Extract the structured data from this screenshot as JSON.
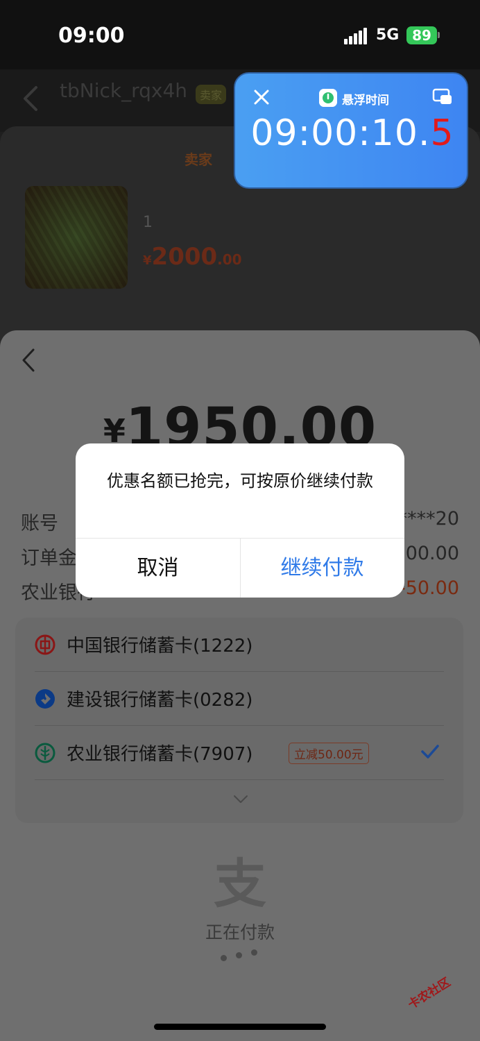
{
  "status_bar": {
    "time": "09:00",
    "network": "5G",
    "battery": "89"
  },
  "chat": {
    "name": "tbNick_rqx4h",
    "tag": "卖家",
    "subtitle": ""
  },
  "order": {
    "seller_label": "卖家",
    "product_title": "1",
    "price_currency": "¥",
    "price_integer": "2000",
    "price_decimal": ".00"
  },
  "float_timer": {
    "title": "悬浮时间",
    "time_main": "09:00:10.",
    "time_last": "5",
    "accent_color": "#3e85f2"
  },
  "payment": {
    "currency": "¥",
    "amount": "1950.00",
    "rows": [
      {
        "label": "账号",
        "value": "****20"
      },
      {
        "label": "订单金额",
        "value": "2000.00"
      },
      {
        "label": "农业银行",
        "value": "-50.00"
      }
    ],
    "banks": [
      {
        "name": "中国银行储蓄卡(1222)",
        "icon": "boc-logo-icon",
        "color": "#9a1a1a"
      },
      {
        "name": "建设银行储蓄卡(0282)",
        "icon": "ccb-logo-icon",
        "color": "#0a3a8a"
      },
      {
        "name": "农业银行储蓄卡(7907)",
        "icon": "abc-logo-icon",
        "color": "#0a6a4a",
        "promo": "立减50.00元",
        "selected": true
      }
    ],
    "paying_text": "正在付款",
    "logo_char": "支"
  },
  "dialog": {
    "message": "优惠名额已抢完，可按原价继续付款",
    "cancel_label": "取消",
    "continue_label": "继续付款"
  },
  "watermark": "卡农社区"
}
